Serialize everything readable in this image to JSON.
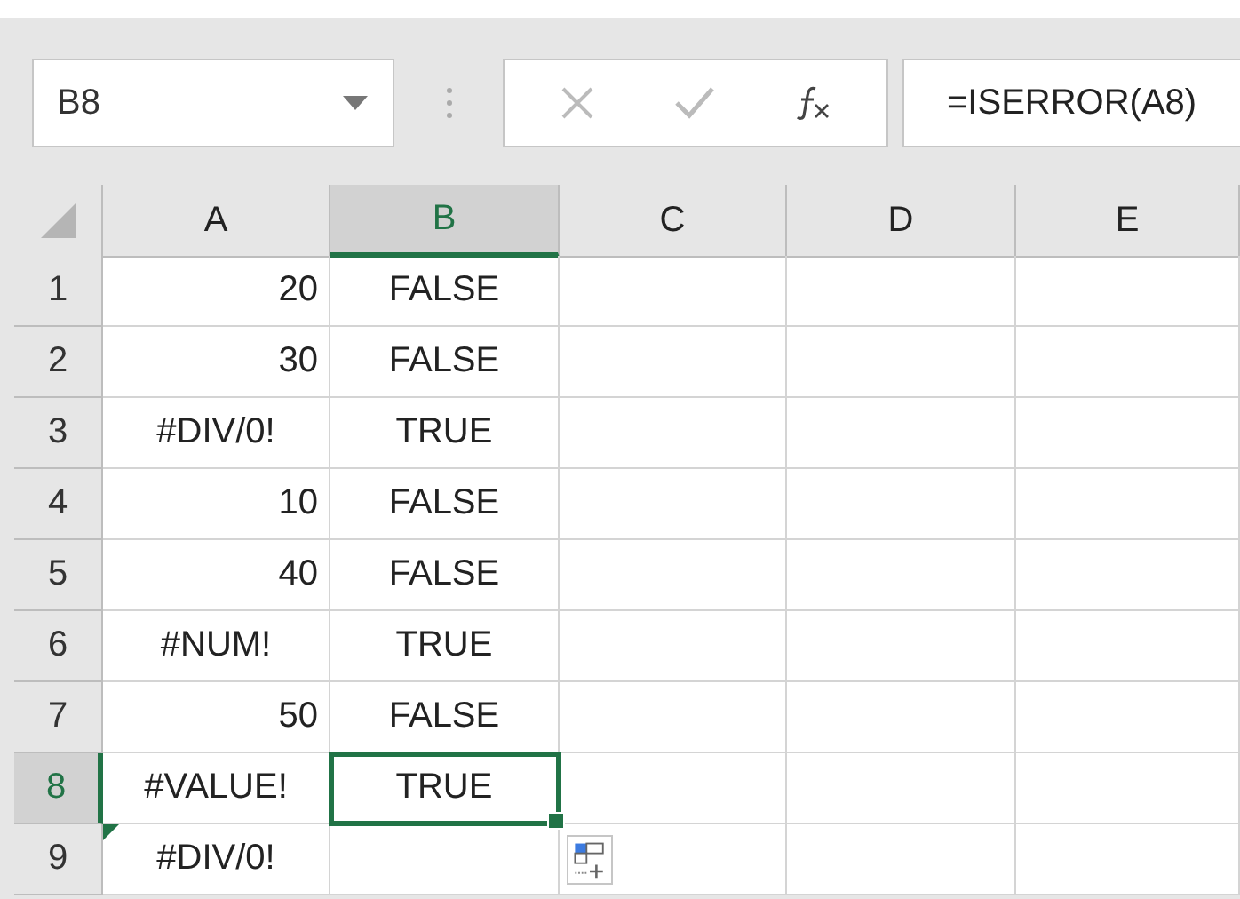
{
  "name_box": "B8",
  "formula": "=ISERROR(A8)",
  "columns": [
    {
      "label": "A",
      "selected": false
    },
    {
      "label": "B",
      "selected": true
    },
    {
      "label": "C",
      "selected": false
    },
    {
      "label": "D",
      "selected": false
    },
    {
      "label": "E",
      "selected": false
    }
  ],
  "rows": [
    {
      "label": "1",
      "selected": false,
      "cells": [
        {
          "value": "20",
          "kind": "number",
          "selected": false,
          "error_flag": false
        },
        {
          "value": "FALSE",
          "kind": "boolean",
          "selected": false,
          "error_flag": false
        }
      ]
    },
    {
      "label": "2",
      "selected": false,
      "cells": [
        {
          "value": "30",
          "kind": "number",
          "selected": false,
          "error_flag": false
        },
        {
          "value": "FALSE",
          "kind": "boolean",
          "selected": false,
          "error_flag": false
        }
      ]
    },
    {
      "label": "3",
      "selected": false,
      "cells": [
        {
          "value": "#DIV/0!",
          "kind": "error",
          "selected": false,
          "error_flag": false
        },
        {
          "value": "TRUE",
          "kind": "boolean",
          "selected": false,
          "error_flag": false
        }
      ]
    },
    {
      "label": "4",
      "selected": false,
      "cells": [
        {
          "value": "10",
          "kind": "number",
          "selected": false,
          "error_flag": false
        },
        {
          "value": "FALSE",
          "kind": "boolean",
          "selected": false,
          "error_flag": false
        }
      ]
    },
    {
      "label": "5",
      "selected": false,
      "cells": [
        {
          "value": "40",
          "kind": "number",
          "selected": false,
          "error_flag": false
        },
        {
          "value": "FALSE",
          "kind": "boolean",
          "selected": false,
          "error_flag": false
        }
      ]
    },
    {
      "label": "6",
      "selected": false,
      "cells": [
        {
          "value": "#NUM!",
          "kind": "error",
          "selected": false,
          "error_flag": false
        },
        {
          "value": "TRUE",
          "kind": "boolean",
          "selected": false,
          "error_flag": false
        }
      ]
    },
    {
      "label": "7",
      "selected": false,
      "cells": [
        {
          "value": "50",
          "kind": "number",
          "selected": false,
          "error_flag": false
        },
        {
          "value": "FALSE",
          "kind": "boolean",
          "selected": false,
          "error_flag": false
        }
      ]
    },
    {
      "label": "8",
      "selected": true,
      "cells": [
        {
          "value": "#VALUE!",
          "kind": "error",
          "selected": false,
          "error_flag": false
        },
        {
          "value": "TRUE",
          "kind": "boolean",
          "selected": true,
          "error_flag": false
        }
      ]
    },
    {
      "label": "9",
      "selected": false,
      "cells": [
        {
          "value": "#DIV/0!",
          "kind": "error",
          "selected": false,
          "error_flag": true
        }
      ]
    }
  ]
}
